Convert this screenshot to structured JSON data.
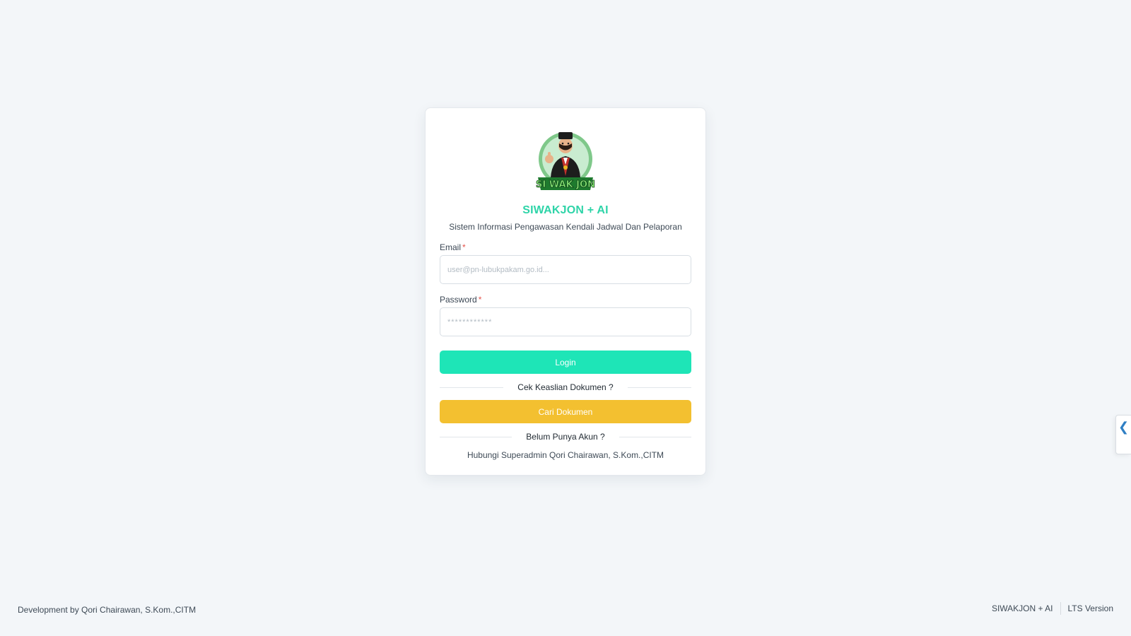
{
  "brand": {
    "logo_text": "SI WAK JON",
    "title": "SIWAKJON + AI",
    "subtitle": "Sistem Informasi Pengawasan Kendali Jadwal Dan Pelaporan"
  },
  "form": {
    "email": {
      "label": "Email",
      "required_mark": "*",
      "placeholder": "user@pn-lubukpakam.go.id...",
      "value": ""
    },
    "password": {
      "label": "Password",
      "required_mark": "*",
      "placeholder": "************",
      "value": ""
    },
    "login_label": "Login"
  },
  "verify": {
    "divider_text": "Cek Keaslian Dokumen ?",
    "button_label": "Cari Dokumen"
  },
  "account": {
    "divider_text": "Belum Punya Akun ?",
    "contact_text": "Hubungi Superadmin Qori Chairawan, S.Kom.,CITM"
  },
  "footer": {
    "credit": "Development by Qori Chairawan, S.Kom.,CITM",
    "app_name": "SIWAKJON + AI",
    "version": "LTS Version"
  },
  "side_toggle": {
    "icon": "chevron-left-icon",
    "glyph": "❮"
  },
  "colors": {
    "accent": "#1ee5b7",
    "title": "#2ed4a8",
    "search_button": "#f3c030",
    "required": "#e5534b",
    "toggle_icon": "#2f7fc4"
  }
}
